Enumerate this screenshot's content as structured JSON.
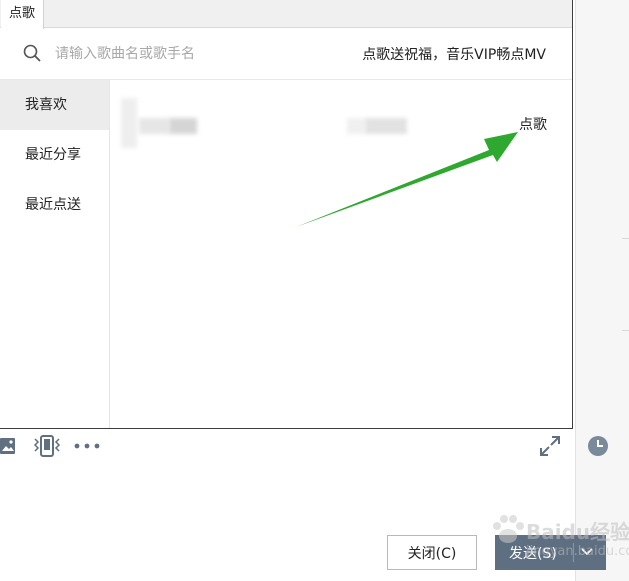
{
  "dialog": {
    "tab_label": "点歌",
    "search": {
      "placeholder": "请输入歌曲名或歌手名",
      "value": ""
    },
    "promo_text": "点歌送祝福，音乐VIP畅点MV",
    "sidebar": {
      "items": [
        {
          "label": "我喜欢",
          "active": true
        },
        {
          "label": "最近分享",
          "active": false
        },
        {
          "label": "最近点送",
          "active": false
        }
      ]
    },
    "song_row": {
      "action_label": "点歌"
    }
  },
  "composer": {
    "close_label": "关闭(C)",
    "send_label": "发送(S)"
  },
  "annotation": {
    "arrow_color": "#2ea82e"
  },
  "watermark": {
    "brand": "Baidu经验",
    "url": "jingyan.baidu.com"
  },
  "colors": {
    "send_button": "#5f6f82",
    "sidebar_active": "#ececec"
  }
}
